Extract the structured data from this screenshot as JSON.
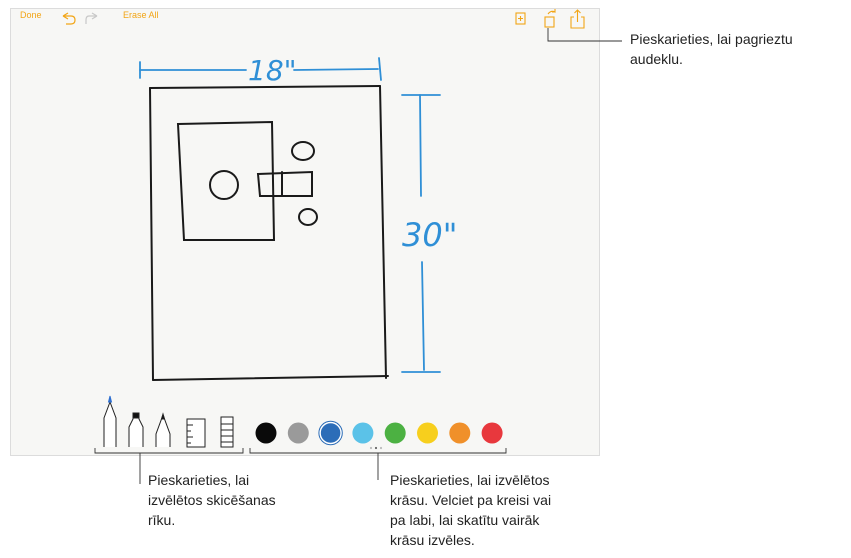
{
  "toolbar": {
    "done_label": "Done",
    "erase_all_label": "Erase All"
  },
  "sketch": {
    "width_label": "18\"",
    "height_label": "30\""
  },
  "palette": {
    "colors": [
      "#0a0a0a",
      "#9a9a9a",
      "#2c6db8",
      "#5bc2e8",
      "#4cb142",
      "#f7cf1d",
      "#f0902a",
      "#e8383d"
    ],
    "page_dots": 3,
    "accent": "#f2a516",
    "ink": "#1a1a1a",
    "blue_ink": "#2f8fd6"
  },
  "tools": [
    "pen",
    "marker",
    "pencil",
    "ruler",
    "eraser"
  ],
  "callouts": {
    "rotate": [
      "Pieskarieties, lai pagrieztu",
      "audeklu."
    ],
    "tools": [
      "Pieskarieties, lai",
      "izvēlētos skicēšanas",
      "rīku."
    ],
    "colors": [
      "Pieskarieties, lai izvēlētos",
      "krāsu. Velciet pa kreisi vai",
      "pa labi, lai skatītu vairāk",
      "krāsu izvēles."
    ]
  }
}
